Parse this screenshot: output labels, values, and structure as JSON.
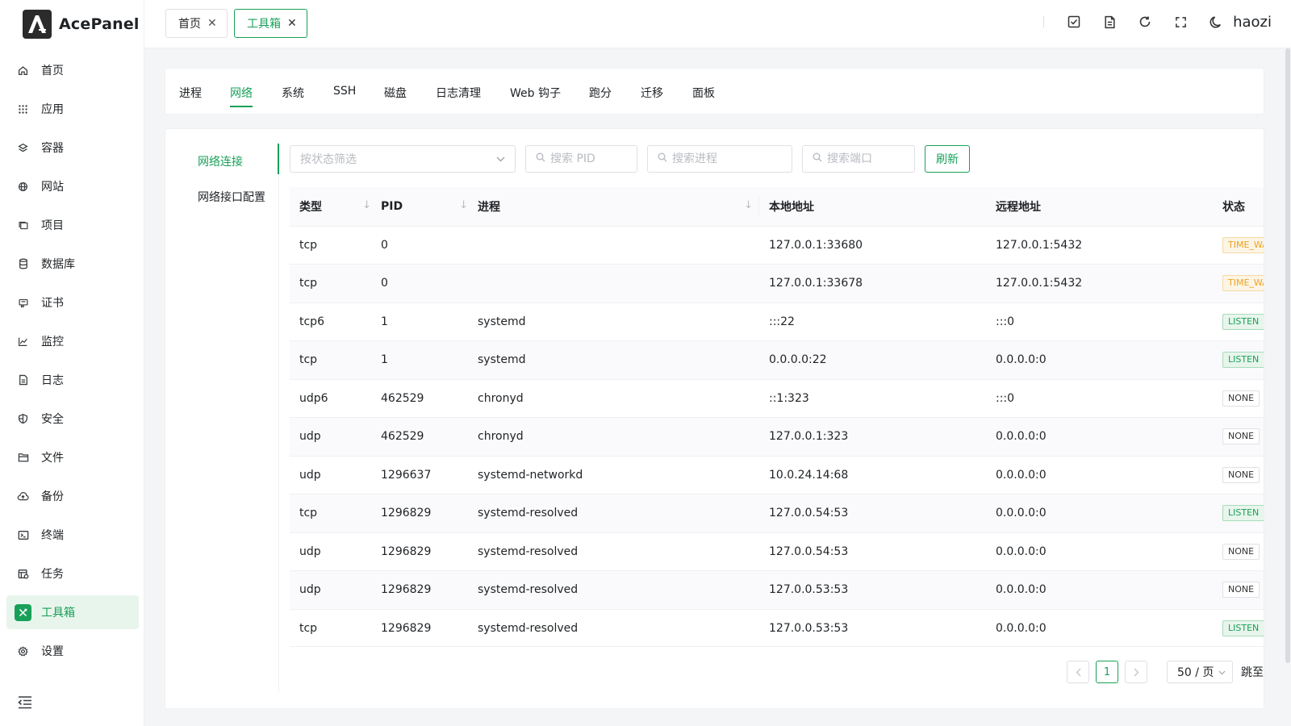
{
  "app": {
    "name": "AcePanel"
  },
  "sidebar": {
    "items": [
      {
        "label": "首页",
        "icon": "home-icon"
      },
      {
        "label": "应用",
        "icon": "apps-grid-icon"
      },
      {
        "label": "容器",
        "icon": "container-icon"
      },
      {
        "label": "网站",
        "icon": "globe-icon"
      },
      {
        "label": "项目",
        "icon": "project-icon"
      },
      {
        "label": "数据库",
        "icon": "database-icon"
      },
      {
        "label": "证书",
        "icon": "certificate-icon"
      },
      {
        "label": "监控",
        "icon": "chart-icon"
      },
      {
        "label": "日志",
        "icon": "log-file-icon"
      },
      {
        "label": "安全",
        "icon": "shield-icon"
      },
      {
        "label": "文件",
        "icon": "folder-icon"
      },
      {
        "label": "备份",
        "icon": "cloud-backup-icon"
      },
      {
        "label": "终端",
        "icon": "terminal-icon"
      },
      {
        "label": "任务",
        "icon": "task-icon"
      },
      {
        "label": "工具箱",
        "icon": "tools-icon",
        "active": true
      },
      {
        "label": "设置",
        "icon": "gear-icon"
      }
    ]
  },
  "header": {
    "tabs": [
      {
        "label": "首页",
        "active": false
      },
      {
        "label": "工具箱",
        "active": true
      }
    ],
    "user": "haozi"
  },
  "toolbox": {
    "tabs": [
      "进程",
      "网络",
      "系统",
      "SSH",
      "磁盘",
      "日志清理",
      "Web 钩子",
      "跑分",
      "迁移",
      "面板"
    ],
    "active_tab": "网络"
  },
  "network": {
    "subnav": [
      "网络连接",
      "网络接口配置"
    ],
    "active_subnav": "网络连接",
    "filters": {
      "status_placeholder": "按状态筛选",
      "pid_placeholder": "搜索 PID",
      "process_placeholder": "搜索进程",
      "port_placeholder": "搜索端口",
      "refresh_label": "刷新"
    },
    "columns": [
      "类型",
      "PID",
      "进程",
      "本地地址",
      "远程地址",
      "状态"
    ],
    "rows": [
      {
        "type": "tcp",
        "pid": "0",
        "process": "",
        "local": "127.0.0.1:33680",
        "remote": "127.0.0.1:5432",
        "status": "TIME_WAIT"
      },
      {
        "type": "tcp",
        "pid": "0",
        "process": "",
        "local": "127.0.0.1:33678",
        "remote": "127.0.0.1:5432",
        "status": "TIME_WAIT"
      },
      {
        "type": "tcp6",
        "pid": "1",
        "process": "systemd",
        "local": ":::22",
        "remote": ":::0",
        "status": "LISTEN"
      },
      {
        "type": "tcp",
        "pid": "1",
        "process": "systemd",
        "local": "0.0.0.0:22",
        "remote": "0.0.0.0:0",
        "status": "LISTEN"
      },
      {
        "type": "udp6",
        "pid": "462529",
        "process": "chronyd",
        "local": "::1:323",
        "remote": ":::0",
        "status": "NONE"
      },
      {
        "type": "udp",
        "pid": "462529",
        "process": "chronyd",
        "local": "127.0.0.1:323",
        "remote": "0.0.0.0:0",
        "status": "NONE"
      },
      {
        "type": "udp",
        "pid": "1296637",
        "process": "systemd-networkd",
        "local": "10.0.24.14:68",
        "remote": "0.0.0.0:0",
        "status": "NONE"
      },
      {
        "type": "tcp",
        "pid": "1296829",
        "process": "systemd-resolved",
        "local": "127.0.0.54:53",
        "remote": "0.0.0.0:0",
        "status": "LISTEN"
      },
      {
        "type": "udp",
        "pid": "1296829",
        "process": "systemd-resolved",
        "local": "127.0.0.54:53",
        "remote": "0.0.0.0:0",
        "status": "NONE"
      },
      {
        "type": "udp",
        "pid": "1296829",
        "process": "systemd-resolved",
        "local": "127.0.0.53:53",
        "remote": "0.0.0.0:0",
        "status": "NONE"
      },
      {
        "type": "tcp",
        "pid": "1296829",
        "process": "systemd-resolved",
        "local": "127.0.0.53:53",
        "remote": "0.0.0.0:0",
        "status": "LISTEN"
      }
    ],
    "pagination": {
      "current_page": "1",
      "page_size": "50 / 页",
      "jump_label": "跳至"
    }
  },
  "colors": {
    "accent": "#18a058",
    "warning": "#f0a020"
  }
}
